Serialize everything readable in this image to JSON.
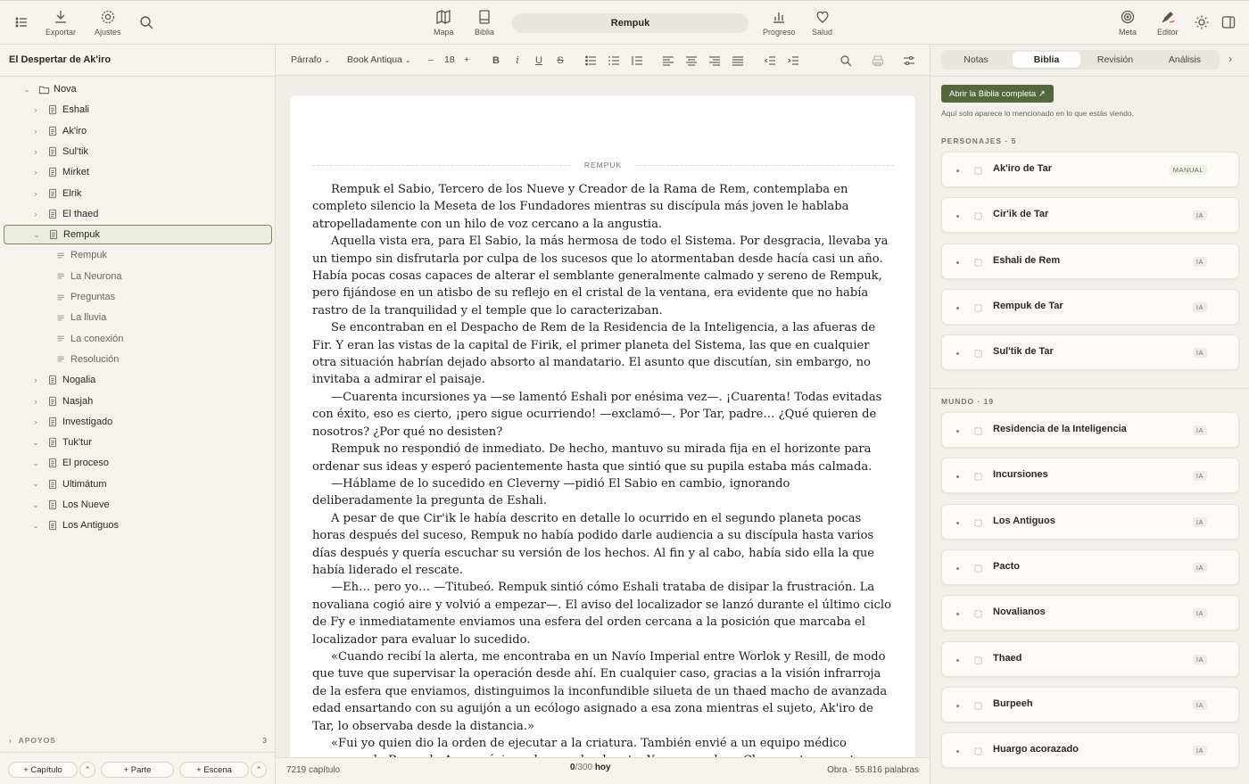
{
  "toolbar": {
    "export_label": "Exportar",
    "settings_label": "Ajustes",
    "map_label": "Mapa",
    "bible_label": "Biblia",
    "document_title": "Rempuk",
    "progress_label": "Progreso",
    "health_label": "Salud",
    "goal_label": "Meta",
    "editor_label": "Editor"
  },
  "sidebar": {
    "project_title": "El Despertar de Ak'iro",
    "tree": [
      {
        "label": "Nova",
        "kind": "folder",
        "chev": "⌄"
      },
      {
        "label": "Eshali",
        "kind": "doc",
        "chev": "›"
      },
      {
        "label": "Ak'iro",
        "kind": "doc",
        "chev": "›"
      },
      {
        "label": "Sul'tik",
        "kind": "doc",
        "chev": "›"
      },
      {
        "label": "Mirket",
        "kind": "doc",
        "chev": "›"
      },
      {
        "label": "Elrik",
        "kind": "doc",
        "chev": "›"
      },
      {
        "label": "El thaed",
        "kind": "doc",
        "chev": "›"
      },
      {
        "label": "Rempuk",
        "kind": "doc",
        "chev": "⌄",
        "selected": true
      },
      {
        "label": "Rempuk",
        "kind": "scene"
      },
      {
        "label": "La Neurona",
        "kind": "scene"
      },
      {
        "label": "Preguntas",
        "kind": "scene"
      },
      {
        "label": "La lluvia",
        "kind": "scene"
      },
      {
        "label": "La conexión",
        "kind": "scene"
      },
      {
        "label": "Resolución",
        "kind": "scene"
      },
      {
        "label": "Nogalia",
        "kind": "doc",
        "chev": "›"
      },
      {
        "label": "Nasjah",
        "kind": "doc",
        "chev": "›"
      },
      {
        "label": "Investigado",
        "kind": "doc",
        "chev": "›"
      },
      {
        "label": "Tuk'tur",
        "kind": "doc",
        "chev": "⌄"
      },
      {
        "label": "El proceso",
        "kind": "doc",
        "chev": "⌄"
      },
      {
        "label": "Ultimátum",
        "kind": "doc",
        "chev": "⌄"
      },
      {
        "label": "Los Nueve",
        "kind": "doc",
        "chev": "⌄"
      },
      {
        "label": "Los Antiguos",
        "kind": "doc",
        "chev": "⌄"
      }
    ],
    "apoyos_label": "APOYOS",
    "apoyos_count": "3",
    "add_chapter": "+ Capítulo",
    "add_part": "+ Parte",
    "add_scene": "+ Escena"
  },
  "format_bar": {
    "style": "Párrafo",
    "font": "Book Antiqua",
    "size": "18",
    "minus": "–",
    "plus": "+"
  },
  "editor": {
    "scene_label": "REMPUK",
    "paragraphs": [
      "Rempuk el Sabio, Tercero de los Nueve y Creador de la Rama de Rem, contemplaba en completo silencio la Meseta de los Fundadores mientras su discípula más joven le hablaba atropelladamente con un hilo de voz cercano a la angustia.",
      "Aquella vista era, para El Sabio, la más hermosa de todo el Sistema. Por desgracia, llevaba ya un tiempo sin disfrutarla por culpa de los sucesos que lo atormentaban desde hacía casi un año. Había pocas cosas capaces de alterar el semblante generalmente calmado y sereno de Rempuk, pero fijándose en un atisbo de su reflejo en el cristal de la ventana, era evidente que no había rastro de la tranquilidad y el temple que lo caracterizaban.",
      "Se encontraban en el Despacho de Rem de la Residencia de la Inteligencia, a las afueras de Fir. Y eran las vistas de la capital de Firik, el primer planeta del Sistema, las que en cualquier otra situación habrían dejado absorto al mandatario. El asunto que discutían, sin embargo, no invitaba a admirar el paisaje.",
      "—Cuarenta incursiones ya —se lamentó Eshali por enésima vez—. ¡Cuarenta! Todas evitadas con éxito, eso es cierto, ¡pero sigue ocurriendo! —exclamó—. Por Tar, padre… ¿Qué quieren de nosotros? ¿Por qué no desisten?",
      "Rempuk no respondió de inmediato. De hecho, mantuvo su mirada fija en el horizonte para ordenar sus ideas y esperó pacientemente hasta que sintió que su pupila estaba más calmada.",
      "—Háblame de lo sucedido en Cleverny —pidió El Sabio en cambio, ignorando deliberadamente la pregunta de Eshali.",
      "A pesar de que Cir'ik le había descrito en detalle lo ocurrido en el segundo planeta pocas horas después del suceso, Rempuk no había podido darle audiencia a su discípula hasta varios días después y quería escuchar su versión de los hechos. Al fin y al cabo, había sido ella la que había liderado el rescate.",
      "—Eh… pero yo… —Titubeó. Rempuk sintió cómo Eshali trataba de disipar la frustración. La novaliana cogió aire y volvió a empezar—. El aviso del localizador se lanzó durante el último ciclo de Fy e inmediatamente enviamos una esfera del orden cercana a la posición que marcaba el localizador para evaluar lo sucedido.",
      "«Cuando recibí la alerta, me encontraba en un Navío Imperial entre Worlok y Resill, de modo que tuve que supervisar la operación desde ahí. En cualquier caso, gracias a la visión infrarroja de la esfera que enviamos, distinguimos la inconfundible silueta de un thaed macho de avanzada edad ensartando con su aguijón a un ecólogo asignado a esa zona mientras el sujeto, Ak'iro de Tar, lo observaba desde la distancia.»",
      "«Fui yo quien dio la orden de ejecutar a la criatura. También envié a un equipo médico cercano a la Rama de Avar próximo al segundo planeta. Y puse rumbo a Cleverny tan pronto estuvimos seguros de la muerte de la bestia. Llegué veinte minutos después de recibir…»"
    ]
  },
  "status": {
    "chapter_words": "7219 capítulo",
    "today_count": "0",
    "today_goal": "/300",
    "today_label": "hoy",
    "total": "Obra · 55.816 palabras"
  },
  "right_panel": {
    "tabs": [
      "Notas",
      "Biblia",
      "Revisión",
      "Análisis"
    ],
    "active_tab": "Biblia",
    "open_bible": "Abrir la Biblia completa ↗",
    "hint": "Aquí solo aparece lo mencionado en lo que estás viendo.",
    "characters_header": "PERSONAJES · 5",
    "characters": [
      {
        "name": "Ak'iro de Tar",
        "badge": "MANUAL"
      },
      {
        "name": "Cir'ik de Tar",
        "badge": "IA"
      },
      {
        "name": "Eshali de Rem",
        "badge": "IA"
      },
      {
        "name": "Rempuk de Tar",
        "badge": "IA"
      },
      {
        "name": "Sul'tik de Tar",
        "badge": "IA"
      }
    ],
    "world_header": "MUNDO · 19",
    "world": [
      {
        "name": "Residencia de la Inteligencia",
        "badge": "IA"
      },
      {
        "name": "Incursiones",
        "badge": "IA"
      },
      {
        "name": "Los Antiguos",
        "badge": "IA"
      },
      {
        "name": "Pacto",
        "badge": "IA"
      },
      {
        "name": "Novalianos",
        "badge": "IA"
      },
      {
        "name": "Thaed",
        "badge": "IA"
      },
      {
        "name": "Burpeeh",
        "badge": "IA"
      },
      {
        "name": "Huargo acorazado",
        "badge": "IA"
      }
    ]
  },
  "colors": {
    "accent_green": "#55683c",
    "selection_border": "#7b8a5a"
  }
}
